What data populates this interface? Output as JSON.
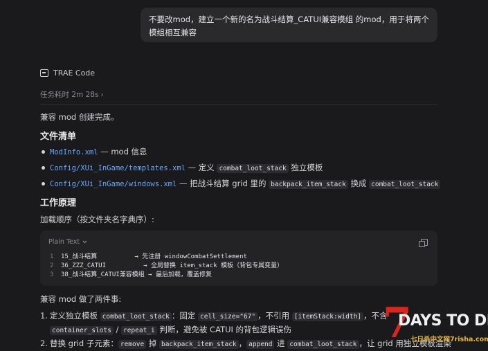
{
  "user_message": "不要改mod，建立一个新的名为战斗结算_CATUI兼容模组 的mod，用于将两个模组相互兼容",
  "assistant": {
    "name": "TRAE Code",
    "duration": "任务耗时 2m 28s",
    "duration_chevron": "›"
  },
  "summary": "兼容 mod 创建完成。",
  "files_heading": "文件清单",
  "files": [
    {
      "name": "ModInfo.xml",
      "desc_a": " — mod 信息"
    },
    {
      "name": "Config/XUi_InGame/templates.xml",
      "desc_a": " — 定义 ",
      "code1": "combat_loot_stack",
      "desc_b": " 独立模板"
    },
    {
      "name": "Config/XUi_InGame/windows.xml",
      "desc_a": " — 把战斗结算 grid 里的 ",
      "code1": "backpack_item_stack",
      "desc_b": " 换成 ",
      "code2": "combat_loot_stack"
    }
  ],
  "principle_heading": "工作原理",
  "load_order_label": "加载顺序（按文件夹名字典序）:",
  "code_block": {
    "language": "Plain Text",
    "lines": [
      {
        "num": "1",
        "text": "15_战斗结算          → 先注册 windowCombatSettlement"
      },
      {
        "num": "2",
        "text": "36_ZZZ_CATUI          → 全局替换 item_stack 模板（背包专属变量）"
      },
      {
        "num": "3",
        "text": "38_战斗结算_CATUI兼容模组 → 最后加载，覆盖修复"
      }
    ]
  },
  "two_things": "兼容 mod 做了两件事:",
  "steps": [
    {
      "num": "1.",
      "a": "定义独立模板 ",
      "c1": "combat_loot_stack",
      "b": "：固定 ",
      "c2": "cell_size=\"67\"",
      "c": "，不引用 ",
      "c3": "[itemStack:width]",
      "d": "，不含 ",
      "c4": "container_slots",
      "e": " / ",
      "c5": "repeat_i",
      "f": " 判断，避免被 CATUI 的背包逻辑误伤"
    },
    {
      "num": "2.",
      "a": "替换 grid 子元素：",
      "c1": "remove",
      "b": " 掉 ",
      "c2": "backpack_item_stack",
      "c": "，",
      "c3": "append",
      "d": " 进 ",
      "c4": "combat_loot_stack",
      "e": "，让 grid 用独立模板渲染"
    }
  ],
  "watermark": {
    "seven": "7",
    "days": "DAYS TO DIE",
    "site": "七日杀中文网7risha.com"
  }
}
